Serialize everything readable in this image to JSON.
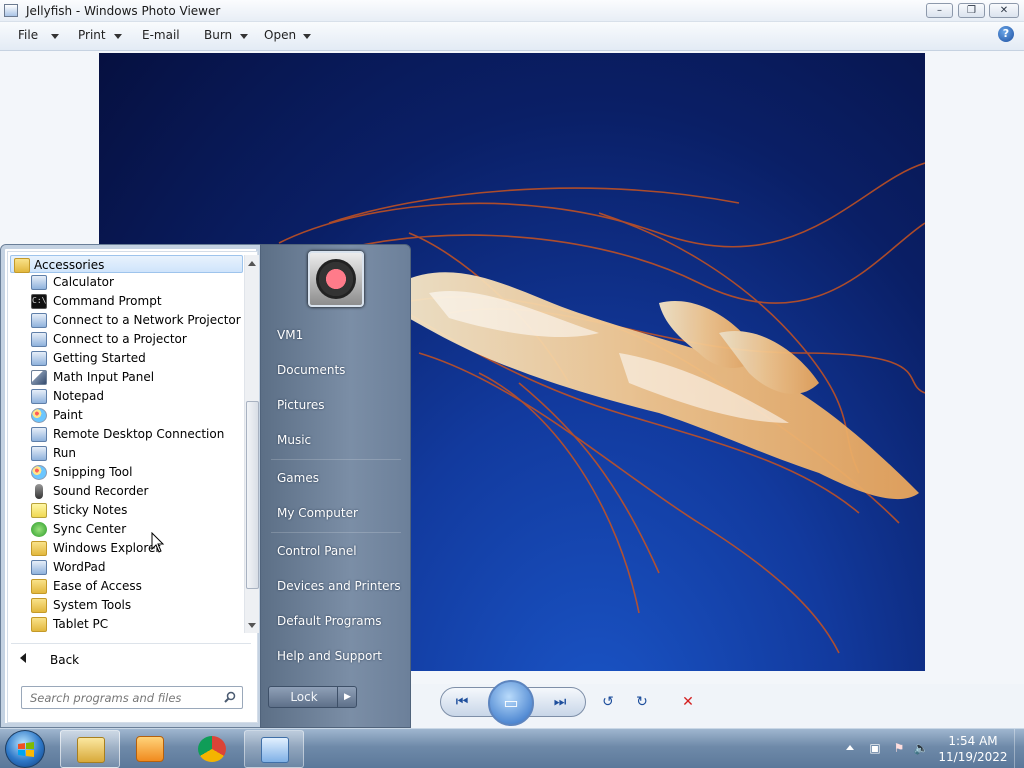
{
  "window": {
    "title": "Jellyfish - Windows Photo Viewer",
    "minimize": "–",
    "maximize": "❐",
    "close": "✕"
  },
  "menu": {
    "file": "File",
    "print": "Print",
    "email": "E-mail",
    "burn": "Burn",
    "open": "Open",
    "help": "?"
  },
  "start_menu": {
    "folder": "Accessories",
    "programs": [
      {
        "label": "Calculator",
        "icon": "calculator-icon"
      },
      {
        "label": "Command Prompt",
        "icon": "command-prompt-icon"
      },
      {
        "label": "Connect to a Network Projector",
        "icon": "network-projector-icon"
      },
      {
        "label": "Connect to a Projector",
        "icon": "projector-icon"
      },
      {
        "label": "Getting Started",
        "icon": "getting-started-icon"
      },
      {
        "label": "Math Input Panel",
        "icon": "math-input-icon"
      },
      {
        "label": "Notepad",
        "icon": "notepad-icon"
      },
      {
        "label": "Paint",
        "icon": "paint-icon"
      },
      {
        "label": "Remote Desktop Connection",
        "icon": "remote-desktop-icon"
      },
      {
        "label": "Run",
        "icon": "run-icon"
      },
      {
        "label": "Snipping Tool",
        "icon": "snipping-tool-icon"
      },
      {
        "label": "Sound Recorder",
        "icon": "microphone-icon"
      },
      {
        "label": "Sticky Notes",
        "icon": "sticky-notes-icon"
      },
      {
        "label": "Sync Center",
        "icon": "sync-icon"
      },
      {
        "label": "Windows Explorer",
        "icon": "explorer-icon"
      },
      {
        "label": "WordPad",
        "icon": "wordpad-icon"
      },
      {
        "label": "Ease of Access",
        "icon": "folder-icon"
      },
      {
        "label": "System Tools",
        "icon": "folder-icon"
      },
      {
        "label": "Tablet PC",
        "icon": "folder-icon"
      }
    ],
    "back": "Back",
    "search_placeholder": "Search programs and files",
    "right": {
      "user": "VM1",
      "documents": "Documents",
      "pictures": "Pictures",
      "music": "Music",
      "games": "Games",
      "computer": "My Computer",
      "control_panel": "Control Panel",
      "devices": "Devices and Printers",
      "default_programs": "Default Programs",
      "help": "Help and Support"
    },
    "lock": "Lock",
    "lock_arrow": "▶"
  },
  "viewer_controls": {
    "prev": "⏮",
    "slideshow": "▭",
    "next": "⏭",
    "rotate_ccw": "↺",
    "rotate_cw": "↻",
    "delete": "✕"
  },
  "taskbar": {
    "time": "1:54 AM",
    "date": "11/19/2022"
  },
  "colors": {
    "accent": "#1d4e9c",
    "delete_red": "#d42020",
    "photo_bg": "#0a1f66"
  }
}
